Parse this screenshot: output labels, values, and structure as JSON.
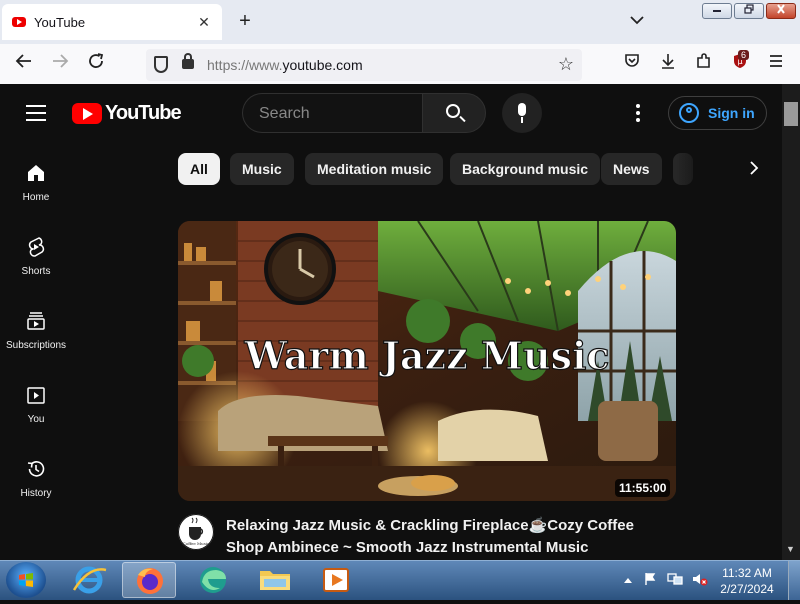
{
  "browser": {
    "tab_title": "YouTube",
    "tab_close": "✕",
    "new_tab": "+",
    "tab_list": "⌄",
    "url_prefix": "https://www.",
    "url_domain": "youtube.com",
    "extension_badge": "6",
    "window_controls": {
      "minimize": "▭",
      "restore": "❐",
      "close": "✕"
    }
  },
  "youtube": {
    "logo_text": "YouTube",
    "search_placeholder": "Search",
    "signin_label": "Sign in",
    "sidebar": [
      {
        "label": "Home",
        "icon": "home-icon"
      },
      {
        "label": "Shorts",
        "icon": "shorts-icon"
      },
      {
        "label": "Subscriptions",
        "icon": "subscriptions-icon"
      },
      {
        "label": "You",
        "icon": "you-icon"
      },
      {
        "label": "History",
        "icon": "history-icon"
      }
    ],
    "chips": [
      "All",
      "Music",
      "Meditation music",
      "Background music",
      "News"
    ],
    "video": {
      "thumbnail_text": "Warm Jazz Music",
      "duration": "11:55:00",
      "title_line1": "Relaxing Jazz Music & Crackling Fireplace☕Cozy Coffee",
      "title_line2": "Shop Ambinece ~ Smooth Jazz Instrumental Music",
      "channel_logo_text": "Coffee Music"
    }
  },
  "taskbar": {
    "time": "11:32 AM",
    "date": "2/27/2024"
  },
  "colors": {
    "background": "#0f0f0f",
    "brand_red": "#ff0000",
    "signin_blue": "#3ea6ff",
    "chip_bg": "#272727"
  }
}
